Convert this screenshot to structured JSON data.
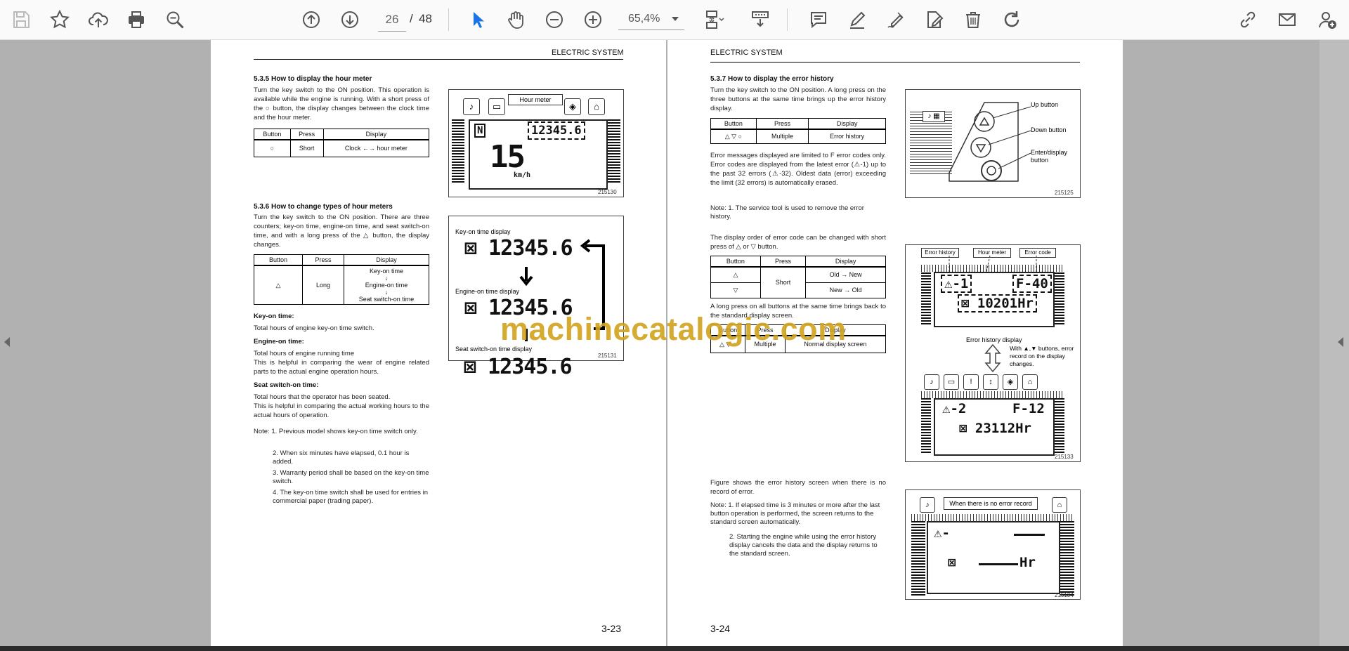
{
  "toolbar": {
    "page_current": "26",
    "page_separator": "/",
    "page_total": "48",
    "zoom": "65,4%",
    "accent_color": "#1b73e8"
  },
  "watermark": "machinecatalogic.com",
  "left_page": {
    "header": "ELECTRIC SYSTEM",
    "page_number": "3-23",
    "s535": {
      "title": "5.3.5   How to display the hour meter",
      "body": "Turn the key switch to the ON position. This operation is available while the engine is running. With a short press of the ○ button, the display changes between the clock time and the hour meter.",
      "table_headers": [
        "Button",
        "Press",
        "Display"
      ],
      "row": [
        "○",
        "Short",
        "Clock ←→ hour meter"
      ],
      "figure_label": "Hour meter",
      "figure_value": "12345.6",
      "figure_speed": "15",
      "figure_unit": "km/h",
      "figure_no": "215130"
    },
    "s536": {
      "title": "5.3.6   How to change types of hour meters",
      "body": "Turn the key switch to the ON position. There are three counters; key-on time, engine-on time, and seat switch-on time, and with a long press of the △ button, the display changes.",
      "table_headers": [
        "Button",
        "Press",
        "Display"
      ],
      "row_button": "△",
      "row_press": "Long",
      "row_display": [
        "Key-on time",
        "↓",
        "Engine-on time",
        "↓",
        "Seat switch-on time"
      ],
      "figure": {
        "key_on_label": "Key-on time display",
        "engine_on_label": "Engine-on time display",
        "seat_label": "Seat switch-on time display",
        "value": "12345.6",
        "figure_no": "215131"
      }
    },
    "defs": {
      "key_on_title": "Key-on time:",
      "key_on_body": "Total hours of engine key-on time switch.",
      "engine_on_title": "Engine-on time:",
      "engine_on_body": "Total hours of engine running time",
      "engine_on_body2": "This is helpful in comparing the wear of engine related parts to the actual engine operation hours.",
      "seat_title": "Seat switch-on time:",
      "seat_body": "Total hours that the operator has been seated.",
      "seat_body2": "This is helpful in comparing the actual working hours to the actual hours of operation."
    },
    "notes": {
      "n1": "Note: 1. Previous model shows key-on time switch only.",
      "n2": "2. When six minutes have elapsed, 0.1 hour is added.",
      "n3": "3. Warranty period shall be based on the key-on time switch.",
      "n4": "4. The key-on time switch shall be used for entries in commercial paper (trading paper)."
    }
  },
  "right_page": {
    "header": "ELECTRIC SYSTEM",
    "page_number": "3-24",
    "s537": {
      "title": "5.3.7   How to display the error history",
      "body": "Turn the key switch to the ON position. A long press on the three buttons at the same time brings up the error history display.",
      "table1_headers": [
        "Button",
        "Press",
        "Display"
      ],
      "table1_row": [
        "△ ▽ ○",
        "Multiple",
        "Error history"
      ],
      "fig1": {
        "up": "Up button",
        "down": "Down button",
        "enter": "Enter/display button",
        "figure_no": "215125"
      },
      "body2": "Error messages displayed are limited to F error codes only. Error codes are displayed from the latest error (⚠-1) up to the past 32 errors (⚠-32). Oldest data (error) exceeding the limit (32 errors) is automatically erased.",
      "note1": "Note: 1. The service tool is used to remove the error history.",
      "body3": "The display order of error code can be changed with short press of △ or ▽ button.",
      "table2_headers": [
        "Button",
        "Press",
        "Display"
      ],
      "table2_rows": [
        [
          "△",
          "Short",
          "Old → New"
        ],
        [
          "▽",
          "",
          "New → Old"
        ]
      ],
      "body4": "A long press on all buttons at the same time brings back to the standard display screen.",
      "table3_headers": [
        "Button",
        "Press",
        "Display"
      ],
      "table3_row": [
        "△ ▽ ○",
        "Multiple",
        "Normal display screen"
      ],
      "fig2": {
        "error_history": "Error history",
        "hour_meter": "Hour meter",
        "error_code": "Error code",
        "top_code_left": "⚠-1",
        "top_code_right": "F-40",
        "top_hours": "10201Hr",
        "caption": "Error history display",
        "side_note": "With ▲,▼ buttons, error record on the display changes.",
        "bottom_code_left": "⚠-2",
        "bottom_code_right": "F-12",
        "bottom_hours": "23112Hr",
        "figure_no": "215133"
      },
      "body5": "Figure shows the error history screen when there is no record of error.",
      "notes": {
        "n1": "Note: 1. If elapsed time is 3 minutes or more after the last button operation is performed, the screen returns to the standard screen automatically.",
        "n2": "2. Starting the engine while using the error history display cancels the data and the display returns to the standard screen."
      },
      "fig3": {
        "label": "When there is no error record",
        "code": "⚠-",
        "hours": "Hr",
        "figure_no": "215134"
      }
    }
  }
}
